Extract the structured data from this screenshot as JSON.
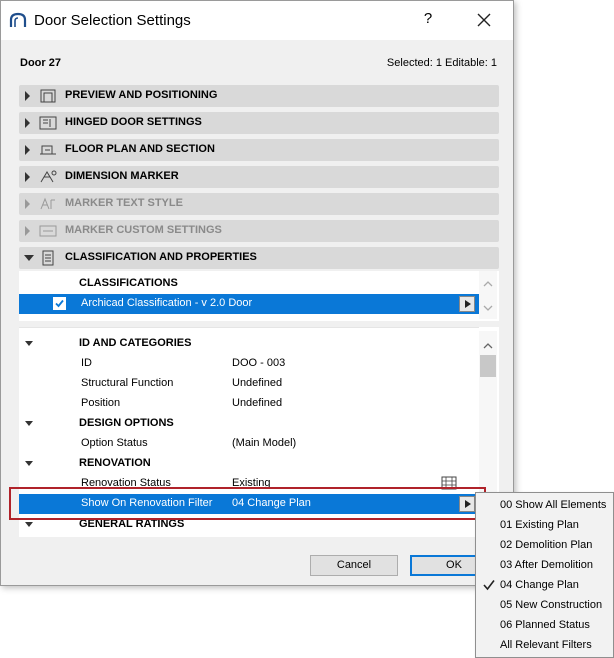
{
  "window": {
    "title": "Door Selection Settings",
    "help": "?",
    "app_icon": "archicad-logo-icon",
    "close_icon": "close-icon"
  },
  "header": {
    "element_name": "Door 27",
    "selection_info": "Selected: 1 Editable: 1"
  },
  "sections": [
    {
      "label": "PREVIEW AND POSITIONING",
      "icon": "preview-icon",
      "enabled": true
    },
    {
      "label": "HINGED DOOR SETTINGS",
      "icon": "hinged-door-icon",
      "enabled": true
    },
    {
      "label": "FLOOR PLAN AND SECTION",
      "icon": "floor-plan-icon",
      "enabled": true
    },
    {
      "label": "DIMENSION MARKER",
      "icon": "dimension-marker-icon",
      "enabled": true
    },
    {
      "label": "MARKER TEXT STYLE",
      "icon": "marker-text-icon",
      "enabled": false
    },
    {
      "label": "MARKER CUSTOM SETTINGS",
      "icon": "marker-custom-icon",
      "enabled": false
    },
    {
      "label": "CLASSIFICATION AND PROPERTIES",
      "icon": "classification-icon",
      "enabled": true,
      "expanded": true
    }
  ],
  "classifications": {
    "header": "CLASSIFICATIONS",
    "item": "Archicad Classification - v 2.0 Door",
    "checked": true
  },
  "properties": {
    "groups": [
      {
        "title": "ID AND CATEGORIES",
        "rows": [
          {
            "label": "ID",
            "value": "DOO - 003"
          },
          {
            "label": "Structural Function",
            "value": "Undefined"
          },
          {
            "label": "Position",
            "value": "Undefined"
          }
        ]
      },
      {
        "title": "DESIGN OPTIONS",
        "rows": [
          {
            "label": "Option Status",
            "value": "(Main Model)"
          }
        ]
      },
      {
        "title": "RENOVATION",
        "rows": [
          {
            "label": "Renovation Status",
            "value": "Existing"
          },
          {
            "label": "Show On Renovation Filter",
            "value": "04 Change Plan"
          }
        ]
      },
      {
        "title": "GENERAL RATINGS",
        "rows": []
      }
    ]
  },
  "buttons": {
    "cancel": "Cancel",
    "ok": "OK"
  },
  "filter_menu": {
    "items": [
      "00 Show All Elements",
      "01 Existing Plan",
      "02 Demolition Plan",
      "03 After Demolition",
      "04 Change Plan",
      "05 New Construction",
      "06 Planned Status",
      "All Relevant Filters"
    ],
    "selected": "04 Change Plan"
  },
  "colors": {
    "selection": "#0a78d7",
    "highlight_box": "#b0232a",
    "section_bg": "#d9d9d9"
  }
}
